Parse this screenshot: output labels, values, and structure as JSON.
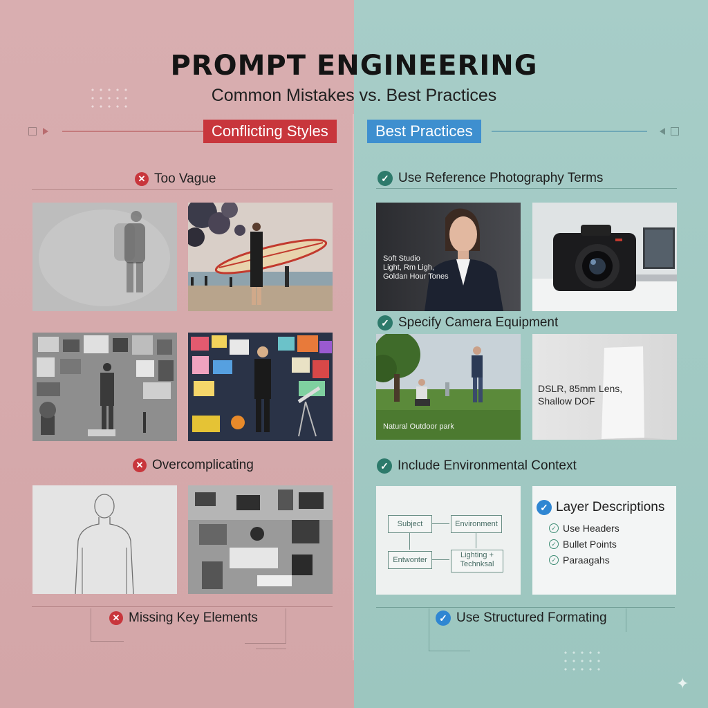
{
  "header": {
    "title": "PROMPT ENGINEERING",
    "subtitle": "Common Mistakes vs. Best Practices"
  },
  "left": {
    "banner": "Conflicting Styles",
    "headings": {
      "too_vague": "Too Vague",
      "overcomplicating": "Overcomplicating",
      "missing_key": "Missing Key Elements"
    }
  },
  "right": {
    "banner": "Best Practices",
    "headings": {
      "reference_photo": "Use Reference Photography Terms",
      "camera_equipment": "Specify Camera Equipment",
      "environment": "Include Environmental Context",
      "structured": "Use Structured Formating"
    },
    "captions": {
      "portrait": "Soft Studio\nLight, Rm Ligh,\nGoldan Hour Tones",
      "park": "Natural Outdoor park",
      "dslr": "DSLR, 85mm Lens,\nShallow DOF"
    },
    "flowchart": {
      "subject": "Subject",
      "environment": "Environment",
      "entwonter": "Entwonter",
      "lighting": "Lighting +\nTechnksal"
    },
    "layer": {
      "title": "Layer Descriptions",
      "items": [
        "Use Headers",
        "Bullet Points",
        "Paraagahs"
      ]
    }
  },
  "colors": {
    "left_bg": "#d6abad",
    "right_bg": "#a3cbc5",
    "red_accent": "#c8363c",
    "blue_accent": "#3e8fcf",
    "green_check": "#2d7a6b"
  }
}
